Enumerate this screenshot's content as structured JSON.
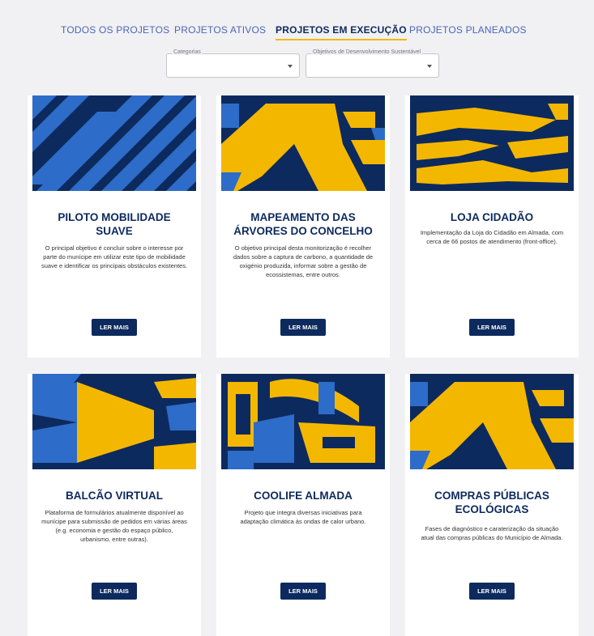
{
  "tabs": [
    {
      "label": "TODOS OS PROJETOS",
      "active": false
    },
    {
      "label": "PROJETOS ATIVOS",
      "active": false
    },
    {
      "label": "PROJETOS EM EXECUÇÃO",
      "active": true
    },
    {
      "label": "PROJETOS PLANEADOS",
      "active": false
    }
  ],
  "filters": {
    "categories_label": "Categorias",
    "ods_label": "Objetivos de Desenvolvimento Sustentável"
  },
  "colors": {
    "navy": "#0d2a5e",
    "yellow": "#f4b700",
    "blue": "#2d6cc8",
    "accent_underline": "#f4b700"
  },
  "cards": [
    {
      "title_lines": [
        "PILOTO MOBILIDADE",
        "SUAVE"
      ],
      "description": "O principal objetivo é concluir sobre o interesse por parte do munícipe em utilizar este tipo de mobilidade suave e identificar os principais obstáculos existentes.",
      "button": "LER MAIS"
    },
    {
      "title_lines": [
        "MAPEAMENTO DAS",
        "ÁRVORES DO CONCELHO"
      ],
      "description": "O objetivo principal desta monitorização é recolher dados sobre a captura de carbono, a quantidade de oxigénio produzida, informar sobre a gestão de ecossistemas, entre outros.",
      "button": "LER MAIS"
    },
    {
      "title_lines": [
        "LOJA CIDADÃO",
        ""
      ],
      "description": "Implementação da Loja do Cidadão em Almada, com cerca de 66 postos de atendimento (front-office).",
      "button": "LER MAIS"
    },
    {
      "title_lines": [
        "BALCÃO VIRTUAL",
        ""
      ],
      "description": "Plataforma de formulários atualmente disponível ao munícipe para submissão de pedidos em várias áreas (e.g. economia e gestão do espaço público, urbanismo, entre outras).",
      "button": "LER MAIS"
    },
    {
      "title_lines": [
        "COOLIFE ALMADA",
        ""
      ],
      "description": "Projeto que integra diversas iniciativas para adaptação climática às ondas de calor urbano.",
      "button": "LER MAIS"
    },
    {
      "title_lines": [
        "COMPRAS PÚBLICAS",
        "ECOLÓGICAS"
      ],
      "description": "Fases de diagnóstico e caraterização da situação atual das compras públicas do Município de Almada.",
      "button": "LER MAIS"
    }
  ]
}
